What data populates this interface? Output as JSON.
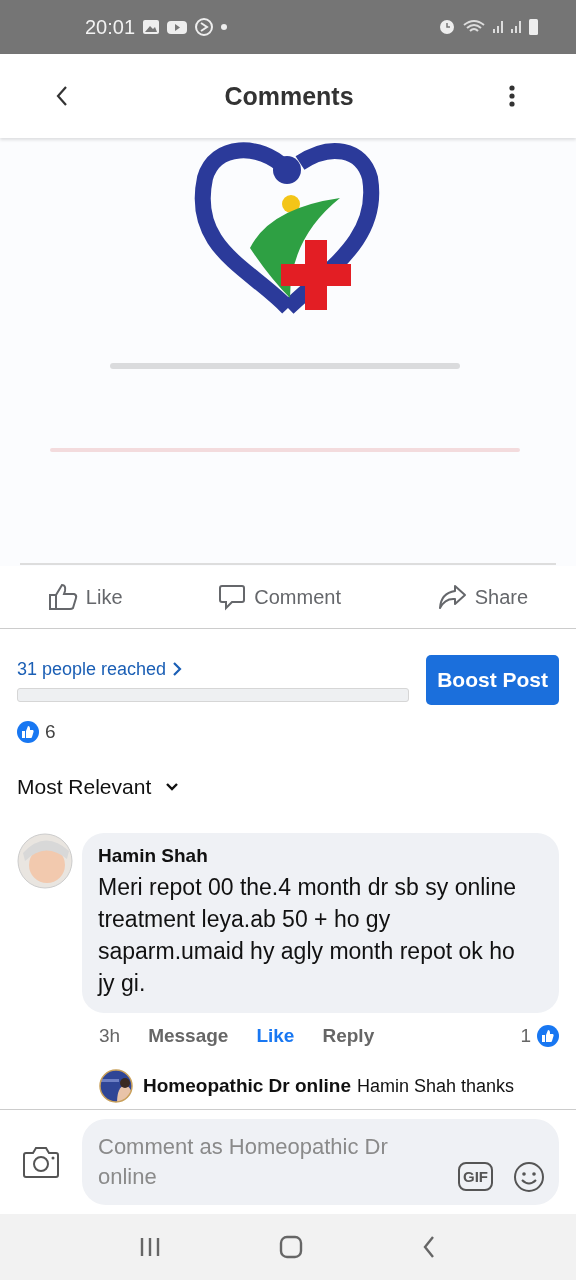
{
  "status_bar": {
    "time": "20:01"
  },
  "header": {
    "title": "Comments"
  },
  "post": {
    "actions": [
      {
        "label": "Like"
      },
      {
        "label": "Comment"
      },
      {
        "label": "Share"
      }
    ]
  },
  "reach": {
    "text": "31 people reached",
    "button": "Boost Post"
  },
  "reactions": {
    "count": "6"
  },
  "sort": {
    "label": "Most Relevant"
  },
  "comments": [
    {
      "author": "Hamin Shah",
      "text": "Meri repot 00 the.4 month dr sb sy online treatment leya.ab 50 + ho gy saparm.umaid hy agly month repot ok ho jy gi.",
      "time": "3h",
      "message": "Message",
      "like": "Like",
      "liked": true,
      "reply": "Reply",
      "reaction_count": "1",
      "replies": [
        {
          "author": "Homeopathic Dr online",
          "text": "Hamin Shah thanks"
        }
      ]
    }
  ],
  "composer": {
    "placeholder": "Comment as Homeopathic Dr online",
    "gif": "GIF"
  }
}
